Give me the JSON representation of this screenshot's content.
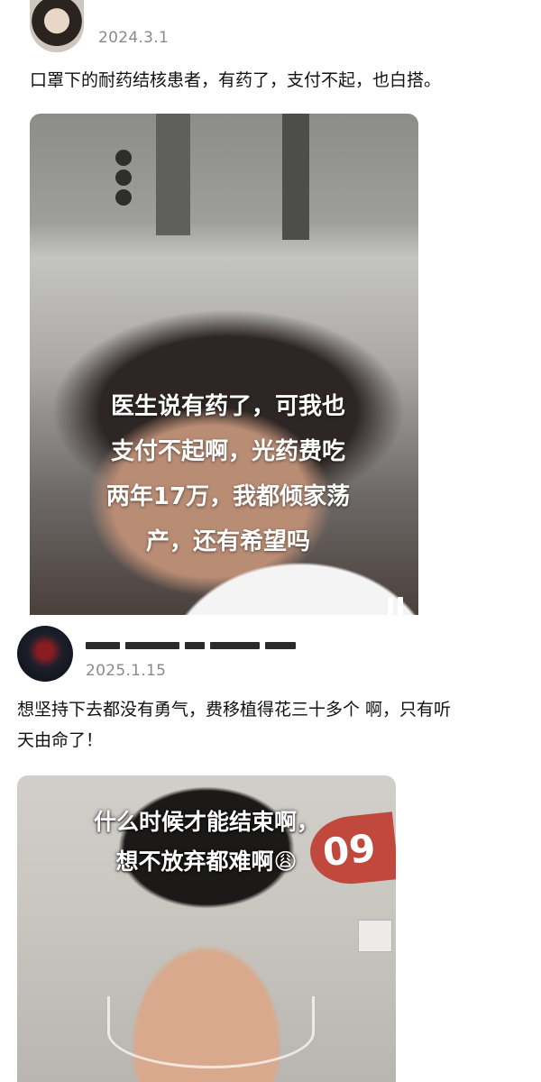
{
  "posts": [
    {
      "date": "2024.3.1",
      "text": "口罩下的耐药结核患者，有药了，支付不起，也白搭。",
      "media": {
        "caption": "医生说有药了，可我也\n支付不起啊，光药费吃\n两年17万，我都倾家荡\n产，还有希望吗"
      }
    },
    {
      "date": "2025.1.15",
      "text": "想坚持下去都没有勇气，费移植得花三十多个 啊，只有听\n天由命了！",
      "media": {
        "caption": "什么时候才能结束啊，\n想不放弃都难啊😩",
        "badge": "09"
      }
    }
  ]
}
